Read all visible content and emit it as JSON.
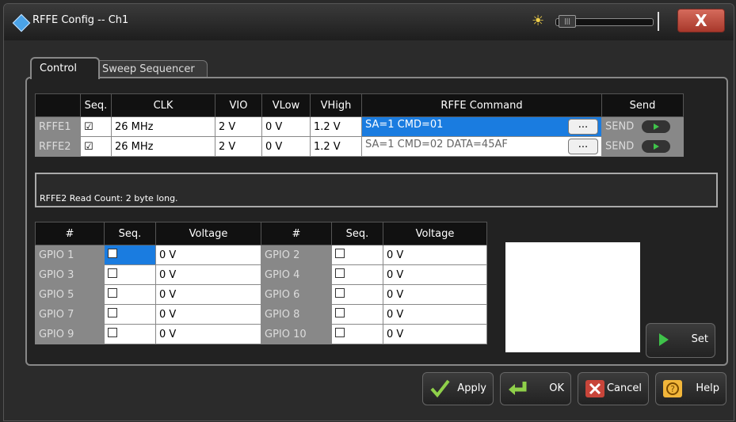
{
  "window": {
    "title": "RFFE Config -- Ch1",
    "close_label": "X"
  },
  "tabs": [
    {
      "label": "Control"
    },
    {
      "label": "Sweep Sequencer"
    }
  ],
  "rffe_table": {
    "headers": [
      "",
      "Seq.",
      "CLK",
      "VIO",
      "VLow",
      "VHigh",
      "RFFE Command",
      "Send"
    ],
    "rows": [
      {
        "name": "RFFE1",
        "seq": "☑",
        "clk": "26 MHz",
        "vio": "2 V",
        "vlow": "0 V",
        "vhigh": "1.2 V",
        "command": "SA=1 CMD=01",
        "send": "SEND"
      },
      {
        "name": "RFFE2",
        "seq": "☑",
        "clk": "26 MHz",
        "vio": "2 V",
        "vlow": "0 V",
        "vhigh": "1.2 V",
        "command": "SA=1 CMD=02 DATA=45AF",
        "send": "SEND"
      }
    ],
    "dots_label": "..."
  },
  "status": {
    "text": "RFFE2 Read Count: 2 byte long."
  },
  "gpio_table": {
    "headers": [
      "#",
      "Seq.",
      "Voltage",
      "#",
      "Seq.",
      "Voltage"
    ],
    "rows": [
      {
        "a": "GPIO 1",
        "av": "0 V",
        "b": "GPIO 2",
        "bv": "0 V"
      },
      {
        "a": "GPIO 3",
        "av": "0 V",
        "b": "GPIO 4",
        "bv": "0 V"
      },
      {
        "a": "GPIO 5",
        "av": "0 V",
        "b": "GPIO 6",
        "bv": "0 V"
      },
      {
        "a": "GPIO 7",
        "av": "0 V",
        "b": "GPIO 8",
        "bv": "0 V"
      },
      {
        "a": "GPIO 9",
        "av": "0 V",
        "b": "GPIO 10",
        "bv": "0 V"
      }
    ]
  },
  "buttons": {
    "set": "Set",
    "apply": "Apply",
    "ok": "OK",
    "cancel": "Cancel",
    "help": "Help"
  },
  "icons": {
    "app": "app-diamond-icon",
    "brightness": "sun-icon",
    "set": "play-icon",
    "apply": "checkmark-icon",
    "ok": "return-arrow-icon",
    "cancel": "x-icon",
    "help": "help-icon"
  },
  "colors": {
    "selection": "#1a7ce0",
    "cancel": "#c8453a",
    "accent_green": "#3fc24a"
  }
}
